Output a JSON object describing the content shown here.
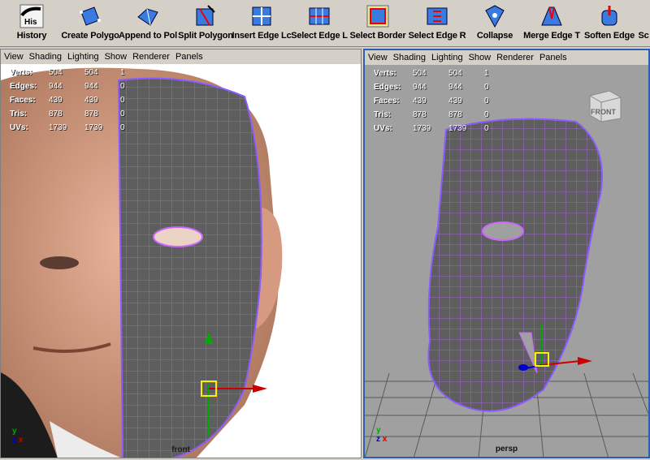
{
  "shelf": {
    "items": [
      {
        "label": "History",
        "icon": "history-icon",
        "icon_text": "His"
      },
      {
        "label": "Create Polygo",
        "icon": "create-polygon-icon"
      },
      {
        "label": "Append to Pol",
        "icon": "append-polygon-icon"
      },
      {
        "label": "Split Polygon ",
        "icon": "split-polygon-icon"
      },
      {
        "label": "Insert Edge Lc",
        "icon": "insert-edge-loop-icon"
      },
      {
        "label": "Select Edge L",
        "icon": "select-edge-loop-icon"
      },
      {
        "label": "Select Border",
        "icon": "select-border-icon"
      },
      {
        "label": "Select Edge R",
        "icon": "select-edge-ring-icon"
      },
      {
        "label": "Collapse",
        "icon": "collapse-icon"
      },
      {
        "label": "Merge Edge T",
        "icon": "merge-edge-icon"
      },
      {
        "label": "Soften Edge",
        "icon": "soften-edge-icon"
      },
      {
        "label": "Sc",
        "icon": "script-icon"
      }
    ]
  },
  "panel_menu": [
    "View",
    "Shading",
    "Lighting",
    "Show",
    "Renderer",
    "Panels"
  ],
  "hud": {
    "rows": [
      {
        "key": "Verts:",
        "a": "504",
        "b": "504",
        "c": "1"
      },
      {
        "key": "Edges:",
        "a": "944",
        "b": "944",
        "c": "0"
      },
      {
        "key": "Faces:",
        "a": "439",
        "b": "439",
        "c": "0"
      },
      {
        "key": "Tris:",
        "a": "878",
        "b": "878",
        "c": "0"
      },
      {
        "key": "UVs:",
        "a": "1739",
        "b": "1739",
        "c": "0"
      }
    ]
  },
  "left_panel": {
    "camera": "front"
  },
  "right_panel": {
    "camera": "persp",
    "viewcube_label": "FRONT"
  },
  "axes": {
    "y": "y",
    "z": "z",
    "x": "x"
  },
  "colors": {
    "active_panel_border": "#2c5fb0",
    "wire": "#cc66ff",
    "axis_x": "#cc0000",
    "axis_y": "#00aa00",
    "axis_z": "#0000cc",
    "manipulator": "#ffee00"
  }
}
